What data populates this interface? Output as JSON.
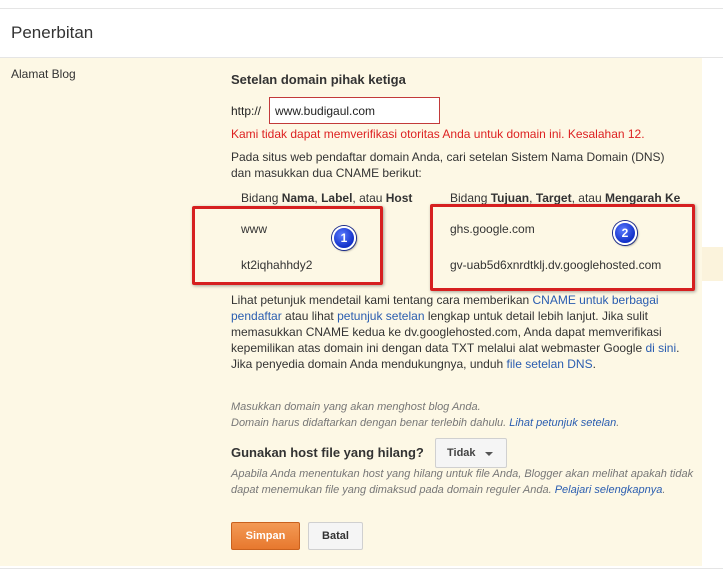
{
  "section_title": "Penerbitan",
  "left_label": "Alamat Blog",
  "domain_settings": {
    "heading": "Setelan domain pihak ketiga",
    "http_prefix": "http://",
    "domain_value": "www.budigaul.com",
    "error": "Kami tidak dapat memverifikasi otoritas Anda untuk domain ini. Kesalahan 12.",
    "description": "Pada situs web pendaftar domain Anda, cari setelan Sistem Nama Domain (DNS) dan masukkan dua CNAME berikut:"
  },
  "cname_table": {
    "name_header": {
      "pre": "Bidang ",
      "b1": "Nama",
      "sep1": ", ",
      "b2": "Label",
      "sep2": ", atau ",
      "b3": "Host"
    },
    "target_header": {
      "pre": "Bidang ",
      "b1": "Tujuan",
      "sep1": ", ",
      "b2": "Target",
      "sep2": ", atau ",
      "b3": "Mengarah Ke"
    },
    "rows": [
      {
        "name": "www",
        "target": "ghs.google.com"
      },
      {
        "name": "kt2iqhahhdy2",
        "target": "gv-uab5d6xnrdtklj.dv.googlehosted.com"
      }
    ],
    "badges": [
      "1",
      "2"
    ],
    "annotation_color": "#d62020"
  },
  "instructions": {
    "t1": "Lihat petunjuk mendetail kami tentang cara memberikan ",
    "link1": "CNAME untuk berbagai pendaftar",
    "t2": " atau lihat ",
    "link2": "petunjuk setelan",
    "t3": " lengkap untuk detail lebih lanjut. Jika sulit memasukkan CNAME kedua ke dv.googlehosted.com, Anda dapat memverifikasi kepemilikan atas domain ini dengan data TXT melalui alat webmaster Google ",
    "link3": "di sini",
    "t4": ".",
    "t5": "Jika penyedia domain Anda mendukungnya, unduh ",
    "link4": "file setelan DNS",
    "t6": "."
  },
  "hints": {
    "line1": "Masukkan domain yang akan menghost blog Anda.",
    "line2": "Domain harus didaftarkan dengan benar terlebih dahulu. ",
    "link": "Lihat petunjuk setelan",
    "end": "."
  },
  "missing_host": {
    "label": "Gunakan host file yang hilang?",
    "selected": "Tidak",
    "help": "Apabila Anda menentukan host yang hilang untuk file Anda, Blogger akan melihat apakah tidak dapat menemukan file yang dimaksud pada domain reguler Anda. ",
    "learn_more": "Pelajari selengkapnya",
    "end": "."
  },
  "buttons": {
    "save": "Simpan",
    "cancel": "Batal"
  },
  "colors": {
    "panel_bg": "#fdf8e5",
    "error": "#dd2222",
    "link": "#2a5db0",
    "save_button": "#e7782e"
  }
}
